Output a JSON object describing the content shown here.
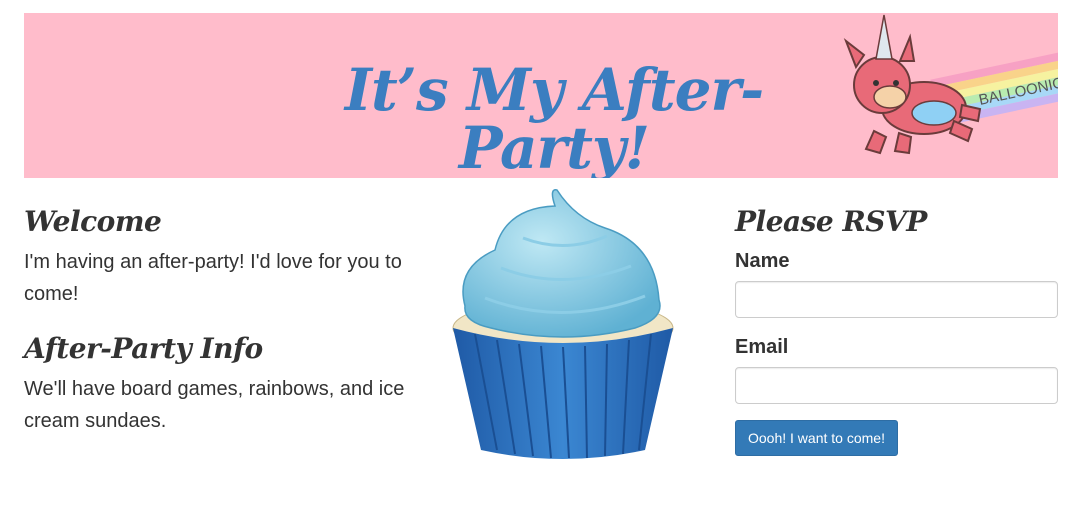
{
  "banner": {
    "title": "It’s My After-Party!",
    "logo_text": "BALLOONICORN",
    "background_color": "#ffbccb",
    "title_color": "#3b7ec0"
  },
  "welcome": {
    "heading": "Welcome",
    "text": "I'm having an after-party! I'd love for you to come!"
  },
  "info": {
    "heading": "After-Party Info",
    "text": "We'll have board games, rainbows, and ice cream sundaes."
  },
  "rsvp": {
    "heading": "Please RSVP",
    "name_label": "Name",
    "name_value": "",
    "email_label": "Email",
    "email_value": "",
    "submit_label": "Oooh! I want to come!",
    "button_color": "#337ab7"
  },
  "images": {
    "cupcake_icon": "cupcake-icon",
    "unicorn_icon": "balloonicorn-icon"
  }
}
